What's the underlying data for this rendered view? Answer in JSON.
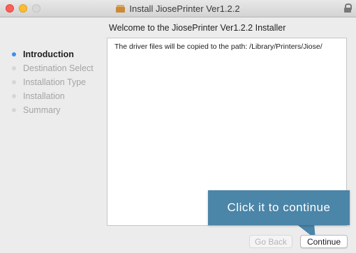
{
  "window": {
    "title": "Install JiosePrinter Ver1.2.2"
  },
  "header": {
    "welcome": "Welcome to the JiosePrinter Ver1.2.2 Installer"
  },
  "sidebar": {
    "steps": [
      {
        "label": "Introduction",
        "active": true
      },
      {
        "label": "Destination Select",
        "active": false
      },
      {
        "label": "Installation Type",
        "active": false
      },
      {
        "label": "Installation",
        "active": false
      },
      {
        "label": "Summary",
        "active": false
      }
    ]
  },
  "content": {
    "text": "The driver files will be copied to the path: /Library/Printers/Jiose/"
  },
  "callout": {
    "text": "Click it to continue"
  },
  "buttons": {
    "back": "Go Back",
    "continue": "Continue"
  },
  "colors": {
    "active_step_dot": "#3f8ef0",
    "callout_bg": "#4b85a8",
    "close": "#fc5f57",
    "minimize": "#fdbc2e"
  }
}
